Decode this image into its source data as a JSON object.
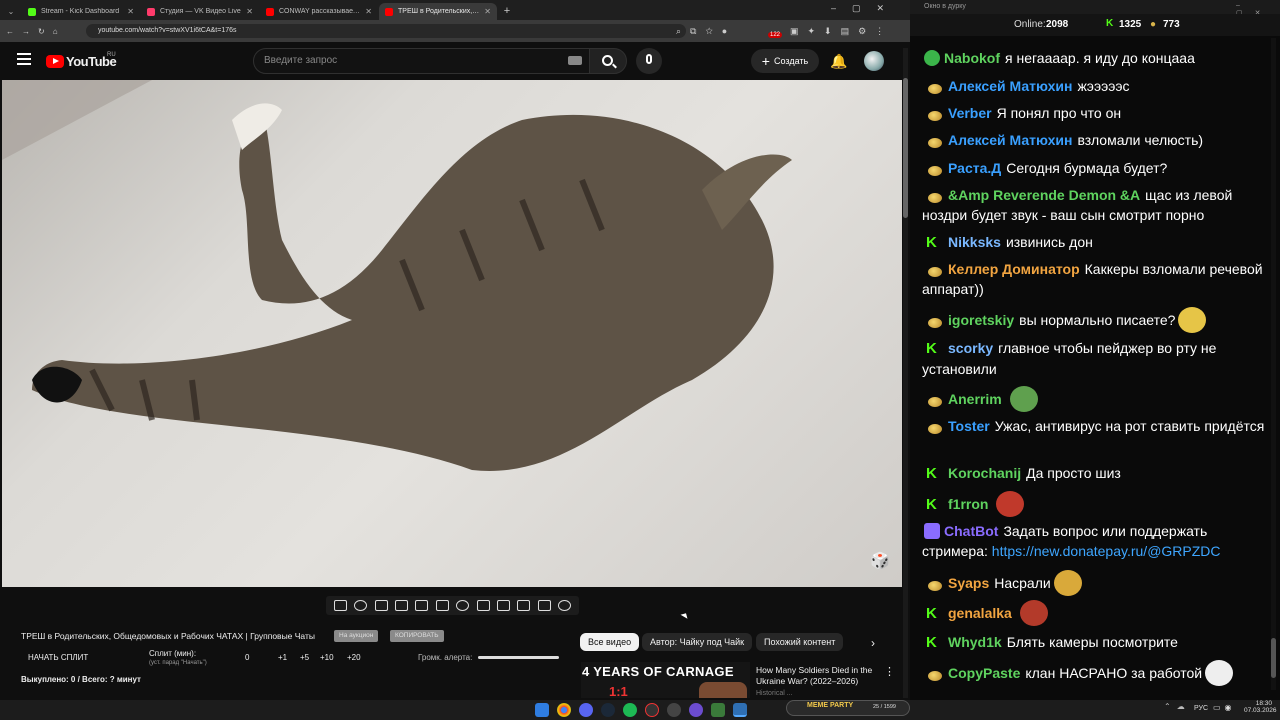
{
  "browser": {
    "tabs": [
      {
        "title": "Stream - Kick Dashboard",
        "color": "#53fc18"
      },
      {
        "title": "Студия — VK Видео Live",
        "color": "#ff3b6b"
      },
      {
        "title": "CONWAY рассказывает как по",
        "color": "#ff0000"
      },
      {
        "title": "ТРЕШ в Родительских, Об",
        "color": "#ff0000"
      }
    ],
    "new_tab": "+",
    "url": "youtube.com/watch?v=stwXV1i6tCA&t=176s",
    "ext_badge": "122"
  },
  "youtube": {
    "logo_text": "YouTube",
    "logo_region": "RU",
    "search_placeholder": "Введите запрос",
    "create_label": "Создать"
  },
  "video_panel": {
    "title": "ТРЕШ в Родительских, Общедомовых и Рабочих ЧАТАХ | Групповые Чаты",
    "btn_grey1": "На аукцион",
    "btn_grey2": "КОПИРОВАТЬ",
    "start_split": "НАЧАТЬ СПЛИТ",
    "split_label": "Сплит (мин):",
    "split_hint": "(уст. парад \"Начать\")",
    "split_value": "0",
    "steps": [
      "+1",
      "+5",
      "+10",
      "+20"
    ],
    "volume_label": "Громк. алерта:",
    "bought": "Выкуплено: 0 / Всего: ? минут"
  },
  "related": {
    "chips": [
      "Все видео",
      "Автор: Чайку под Чайк",
      "Похожий контент"
    ],
    "thumb_text": "4 YEARS OF CARNAGE",
    "thumb_sub": "1:1",
    "video_title": "How Many Soldiers Died in the Ukraine War? (2022–2026)",
    "channel": "Historical ...",
    "more": "⋮"
  },
  "chat": {
    "window_title": "Окно в дурку",
    "online_label": "Online:",
    "online_value": "2098",
    "kick_count": "1325",
    "other_count": "773",
    "messages": [
      {
        "nick": "Nabokof",
        "color": "#5fd35f",
        "text": "я негаааар. я иду до концааа",
        "badge": "check"
      },
      {
        "nick": "Алексей Матюхин",
        "color": "#3aa0ff",
        "text": "жэээээс",
        "badge": "star"
      },
      {
        "nick": "Verber",
        "color": "#3aa0ff",
        "text": "Я понял про что он",
        "badge": "star"
      },
      {
        "nick": "Алексей Матюхин",
        "color": "#3aa0ff",
        "text": "взломали челюсть)",
        "badge": "star"
      },
      {
        "nick": "Раста.Д",
        "color": "#3aa0ff",
        "text": "Сегодня бурмада будет?",
        "badge": "star"
      },
      {
        "nick": "&Amp Reverende Demon &A",
        "color": "#5fd35f",
        "text": "щас из левой ноздри будет звук - ваш сын смотрит порно",
        "badge": "star"
      },
      {
        "nick": "Nikksks",
        "color": "#7ab8ff",
        "text": "извинись дон",
        "badge": "kick"
      },
      {
        "nick": "Келлер Доминатор",
        "color": "#f2a541",
        "text": "Каккеры взломали речевой аппарат))",
        "badge": "star"
      },
      {
        "nick": "igoretskiy",
        "color": "#5fd35f",
        "text": "вы нормально писаете?",
        "badge": "star"
      },
      {
        "nick": "scorky",
        "color": "#7ab8ff",
        "text": "главное чтобы пейджер во рту не установили",
        "badge": "kick"
      },
      {
        "nick": "Anerrim",
        "color": "#5fd35f",
        "text": "",
        "badge": "star"
      },
      {
        "nick": "Toster",
        "color": "#3aa0ff",
        "text": "Ужас, антивирус на рот ставить придётся",
        "badge": "star"
      },
      {
        "nick": "Korochanij",
        "color": "#5fd35f",
        "text": "Да просто шиз",
        "badge": "kick"
      },
      {
        "nick": "f1rron",
        "color": "#5fd35f",
        "text": "",
        "badge": "kick"
      },
      {
        "nick": "ChatBot",
        "color": "#8a6cff",
        "text": "Задать вопрос или поддержать стримера:",
        "link": "https://new.donatepay.ru/@GRPZDC",
        "badge": "bot"
      },
      {
        "nick": "Syaps",
        "color": "#f2a541",
        "text": "Насрали",
        "badge": "star"
      },
      {
        "nick": "genalalka",
        "color": "#f2a541",
        "text": "",
        "badge": "kick"
      },
      {
        "nick": "Whyd1k",
        "color": "#5fd35f",
        "text": "Блять камеры посмотрите",
        "badge": "kick"
      },
      {
        "nick": "CopyPaste",
        "color": "#5fd35f",
        "text": "клан НАСРАНО за работой",
        "badge": "star"
      }
    ]
  },
  "taskbar": {
    "music_title": "MEME PARTY",
    "music_time": "25 / 1599",
    "lang": "РУС",
    "time": "18:30",
    "date": "07.03.2026"
  }
}
